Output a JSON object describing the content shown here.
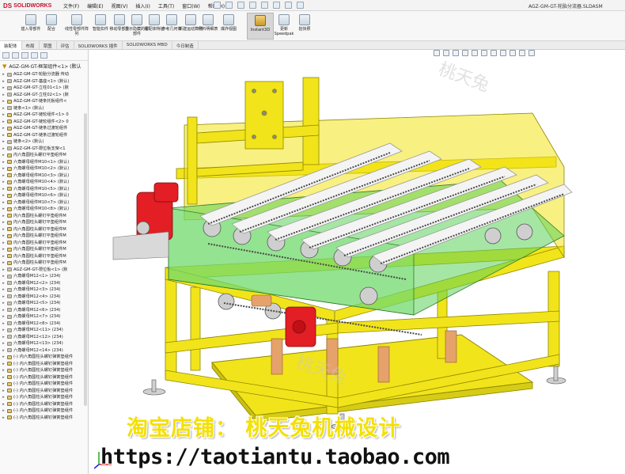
{
  "app": {
    "logo_ds": "DS",
    "logo_name": "SOLIDWORKS",
    "document_title": "AGZ-GM-GT-轮胎分流器.SLDASM"
  },
  "menu": [
    "文件(F)",
    "编辑(E)",
    "视图(V)",
    "插入(I)",
    "工具(T)",
    "窗口(W)",
    "帮助(H)"
  ],
  "ribbon": [
    {
      "label": "插入零部件",
      "icon": "insert-component-icon"
    },
    {
      "label": "配合",
      "icon": "mate-icon"
    },
    {
      "label": "线性零部件阵列",
      "icon": "linear-pattern-icon"
    },
    {
      "label": "智能扣件",
      "icon": "smart-fastener-icon"
    },
    {
      "label": "移动零部件",
      "icon": "move-component-icon"
    },
    {
      "label": "显示隐藏的零部件",
      "icon": "show-hidden-icon"
    },
    {
      "label": "装配体特征",
      "icon": "assembly-feature-icon"
    },
    {
      "label": "参考几何体",
      "icon": "reference-geometry-icon"
    },
    {
      "label": "新建运动算例",
      "icon": "motion-study-icon"
    },
    {
      "label": "材料明细表",
      "icon": "bom-icon"
    },
    {
      "label": "爆炸视图",
      "icon": "explode-icon"
    },
    {
      "label": "Instant3D",
      "icon": "instant3d-icon",
      "active": true
    },
    {
      "label": "更新Speedpak",
      "icon": "speedpak-icon"
    },
    {
      "label": "拍快照",
      "icon": "snapshot-icon"
    }
  ],
  "tabs": [
    "装配体",
    "布局",
    "草图",
    "评估",
    "SOLIDWORKS 插件",
    "SOLIDWORKS MBD",
    "今日制造"
  ],
  "tree": {
    "root": "AGZ-GM-GT-框架组件<1> (默认",
    "items": [
      "AGZ-GM-GT-轮胎分流器 传动",
      "AGZ-GM-GT-基座<1> (默认)",
      "AGZ-GM-GT-立柱01<1> (默",
      "AGZ-GM-GT-立柱02<1> (默",
      "AGZ-GM-GT-链条托板组件<",
      "链条<1> (默认)",
      "AGZ-GM-GT-链轮组件<1> 0",
      "AGZ-GM-GT-链轮组件<2> 0",
      "AGZ-GM-GT-链条过渡轮组件",
      "AGZ-GM-GT-链条过渡轮组件",
      "链条<2> (默认)",
      "AGZ-GM-GT-限位板支架<1",
      "内六角圆柱头螺钉平垫组件M",
      "六角螺母组件M10<1> (默认)",
      "六角螺母组件M10<2> (默认)",
      "六角螺母组件M10<3> (默认)",
      "六角螺母组件M10<4> (默认)",
      "六角螺母组件M10<5> (默认)",
      "六角螺母组件M10<6> (默认)",
      "六角螺母组件M10<7> (默认)",
      "六角螺母组件M10<8> (默认)",
      "内六角圆柱头螺钉平垫组件M",
      "内六角圆柱头螺钉平垫组件M",
      "内六角圆柱头螺钉平垫组件M",
      "内六角圆柱头螺钉平垫组件M",
      "内六角圆柱头螺钉平垫组件M",
      "内六角圆柱头螺钉平垫组件M",
      "内六角圆柱头螺钉平垫组件M",
      "内六角圆柱头螺钉平垫组件M",
      "AGZ-GM-GT-限位板<1> (默",
      "六角螺母M12<1> (234)",
      "六角螺母M12<2> (234)",
      "六角螺母M12<3> (234)",
      "六角螺母M12<4> (234)",
      "六角螺母M12<5> (234)",
      "六角螺母M12<6> (234)",
      "六角螺母M12<7> (234)",
      "六角螺母M12<8> (234)",
      "六角螺母M12<11> (234)",
      "六角螺母M12<12> (234)",
      "六角螺母M12<13> (234)",
      "六角螺母M12<14> (234)",
      "(-) 内六角圆柱头螺钉弹簧垫组件",
      "(-) 内六角圆柱头螺钉弹簧垫组件",
      "(-) 内六角圆柱头螺钉弹簧垫组件",
      "(-) 内六角圆柱头螺钉弹簧垫组件",
      "(-) 内六角圆柱头螺钉弹簧垫组件",
      "(-) 内六角圆柱头螺钉弹簧垫组件",
      "(-) 内六角圆柱头螺钉弹簧垫组件",
      "(-) 内六角圆柱头螺钉弹簧垫组件",
      "(-) 内六角圆柱头螺钉弹簧垫组件",
      "(-) 内六角圆柱头螺钉弹簧垫组件"
    ]
  },
  "watermark": {
    "shop": "淘宝店铺： 桃天兔机械设计",
    "url": "https://taotiantu.taobao.com",
    "logo_text": "桃天兔"
  },
  "colors": {
    "frame_yellow": "#f2e41a",
    "motor_red": "#e31e24",
    "guard_green": "#5dd15a",
    "roller_white": "#f4f4f4"
  }
}
